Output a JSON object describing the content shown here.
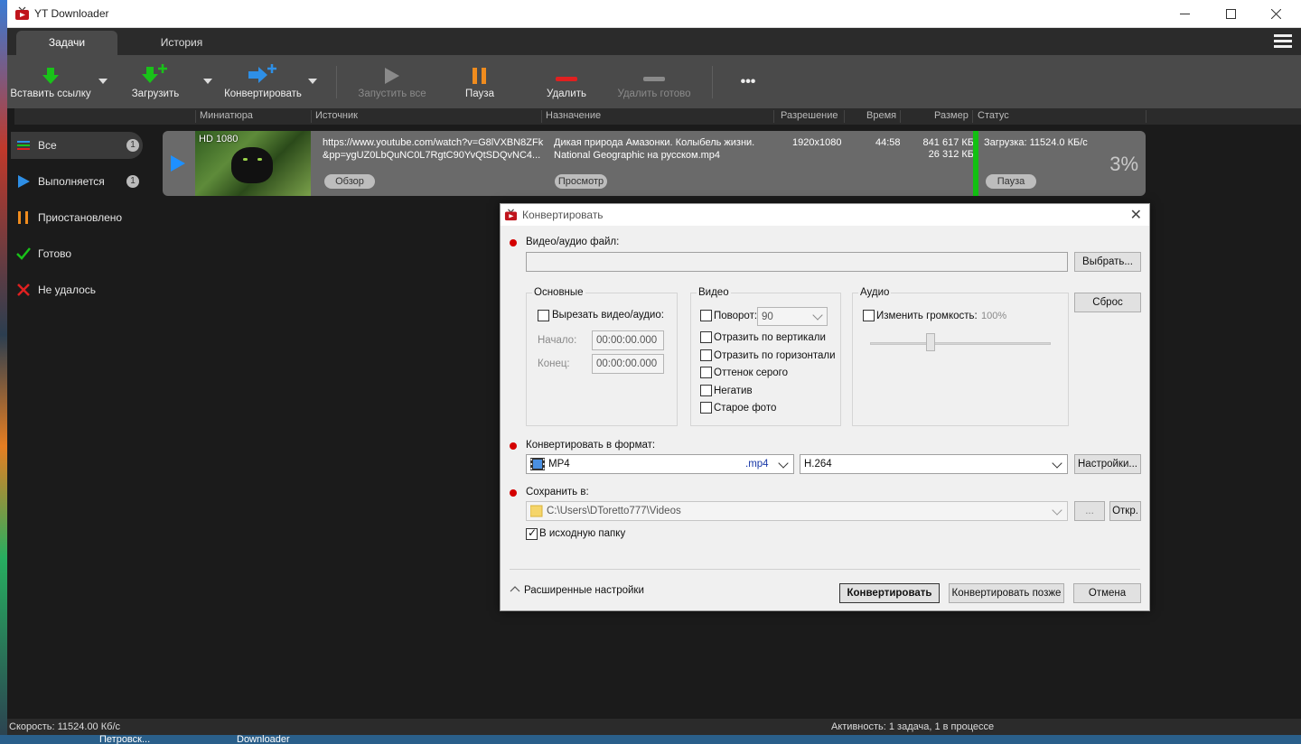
{
  "window": {
    "title": "YT Downloader"
  },
  "tabs": [
    {
      "label": "Задачи"
    },
    {
      "label": "История"
    }
  ],
  "toolbar": {
    "paste": "Вставить ссылку",
    "download": "Загрузить",
    "convert": "Конвертировать",
    "start_all": "Запустить все",
    "pause": "Пауза",
    "delete": "Удалить",
    "delete_done": "Удалить готово",
    "more": "•••"
  },
  "columns": {
    "thumb": "Миниатюра",
    "source": "Источник",
    "dest": "Назначение",
    "resolution": "Разрешение",
    "time": "Время",
    "size": "Размер",
    "status": "Статус"
  },
  "sidebar": {
    "items": [
      {
        "label": "Все",
        "badge": "1"
      },
      {
        "label": "Выполняется",
        "badge": "1"
      },
      {
        "label": "Приостановлено"
      },
      {
        "label": "Готово"
      },
      {
        "label": "Не удалось"
      }
    ]
  },
  "task": {
    "quality": "HD 1080",
    "source_line1": "https://www.youtube.com/watch?v=G8lVXBN8ZFk",
    "source_line2": "&pp=ygUZ0LbQuNC0L7RgtC90YvQtSDQvNC4...",
    "dest_line1": "Дикая природа Амазонки. Колыбель жизни.",
    "dest_line2": "National Geographic на русском.mp4",
    "resolution": "1920x1080",
    "time": "44:58",
    "size1": "841 617 КБ",
    "size2": "26 312 КБ",
    "status": "Загрузка: 11524.0 КБ/с",
    "progress_text": "3%",
    "progress": 0.03,
    "browse_btn": "Обзор",
    "preview_btn": "Просмотр",
    "pause_btn": "Пауза"
  },
  "statusbar": {
    "speed": "Скорость: 11524.00 Кб/с",
    "activity": "Активность: 1 задача, 1 в процессе"
  },
  "desktop": {
    "taskbar_left": "Петровск...",
    "taskbar_mid": "Downloader"
  },
  "dialog": {
    "title": "Конвертировать",
    "file_label": "Видео/аудио файл:",
    "choose_btn": "Выбрать...",
    "reset_btn": "Сброс",
    "basic": {
      "title": "Основные",
      "cut": "Вырезать видео/аудио:",
      "start_label": "Начало:",
      "end_label": "Конец:",
      "start_value": "00:00:00.000",
      "end_value": "00:00:00.000"
    },
    "video": {
      "title": "Видео",
      "rotate": "Поворот:",
      "rotate_value": "90",
      "flip_v": "Отразить по вертикали",
      "flip_h": "Отразить по горизонтали",
      "gray": "Оттенок серого",
      "negative": "Негатив",
      "old_photo": "Старое фото"
    },
    "audio": {
      "title": "Аудио",
      "volume": "Изменить громкость:",
      "volume_value": "100%",
      "volume_level": 0.33
    },
    "format_label": "Конвертировать в формат:",
    "format_value": "MP4",
    "format_ext": ".mp4",
    "codec_value": "H.264",
    "settings_btn": "Настройки...",
    "save_label": "Сохранить в:",
    "save_path": "C:\\Users\\DToretto777\\Videos",
    "browse_dots": "...",
    "open_btn": "Откр.",
    "source_folder": "В исходную папку",
    "advanced": "Расширенные настройки",
    "convert_btn": "Конвертировать",
    "convert_later_btn": "Конвертировать позже",
    "cancel_btn": "Отмена"
  },
  "colors": {
    "accent_green": "#12c012",
    "progress_blue": "#1e90ff",
    "pause_orange": "#f08c1e",
    "delete_red": "#e02020"
  }
}
